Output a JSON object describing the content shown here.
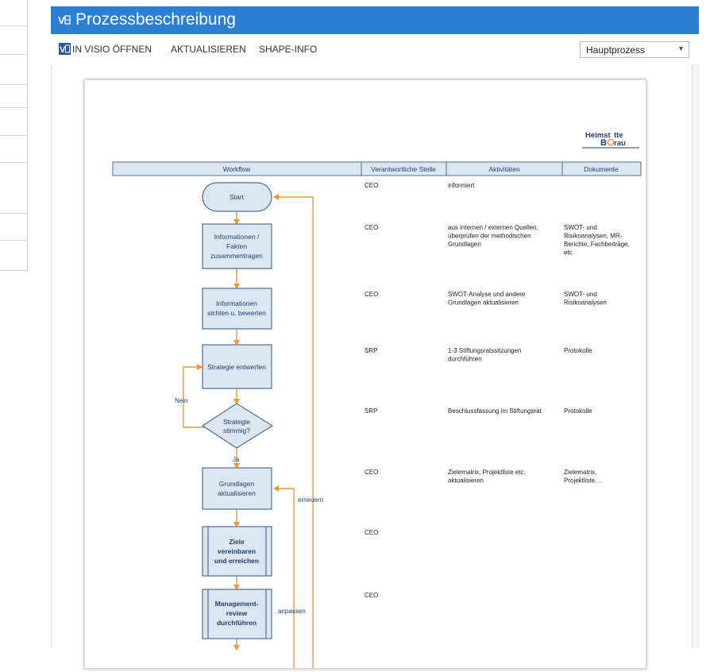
{
  "window": {
    "title": "Prozessbeschreibung"
  },
  "toolbar": {
    "open_in_visio": "IN VISIO ÖFFNEN",
    "refresh": "AKTUALISIEREN",
    "shape_info": "SHAPE-INFO",
    "page_select": {
      "value": "Hauptprozess"
    }
  },
  "diagram": {
    "logo": {
      "line1": "Heimst",
      "line1b": "tte",
      "line2a": "B",
      "line2b": "rau"
    },
    "columns": [
      "Workflow",
      "Verantwortliche Stelle",
      "Aktivitäten",
      "Dokumente"
    ],
    "shapes": {
      "start": "Start",
      "step1": [
        "Informationen /",
        "Fakten",
        "zusammentragen"
      ],
      "step2": [
        "Informationen",
        "sichten u. bewerten"
      ],
      "step3": "Strategie entwerfen",
      "decision": [
        "Strategie",
        "stimmig?"
      ],
      "step4": [
        "Grundlagen",
        "aktualisieren"
      ],
      "sub1": [
        "Ziele",
        "vereinbaren",
        "und erreichen"
      ],
      "sub2": [
        "Management-",
        "review",
        "durchführen"
      ]
    },
    "flow_labels": {
      "no": "Nein",
      "yes": "Ja",
      "renew": "erneuern",
      "adjust": "anpassen"
    },
    "rows": [
      {
        "stelle": "CEO",
        "aktivitaeten": [
          "informiert"
        ],
        "dokumente": []
      },
      {
        "stelle": "CEO",
        "aktivitaeten": [
          "aus internen / externen Quellen,",
          "überprüfen der methodischen",
          "Grundlagen"
        ],
        "dokumente": [
          "SWOT- und",
          "Risikoanalysen, MR-",
          "Berichte, Fachbeiträge,",
          "etc."
        ]
      },
      {
        "stelle": "CEO",
        "aktivitaeten": [
          "SWOT-Analyse und andere",
          "Grundlagen aktualisieren"
        ],
        "dokumente": [
          "SWOT- und",
          "Risikoanalysen"
        ]
      },
      {
        "stelle": "SRP",
        "aktivitaeten": [
          "1-3 Stiftungsratssitzungen",
          "durchführen"
        ],
        "dokumente": [
          "Protokolle"
        ]
      },
      {
        "stelle": "SRP",
        "aktivitaeten": [
          "Beschlussfassung im Stiftungsrat"
        ],
        "dokumente": [
          "Protokolle"
        ]
      },
      {
        "stelle": "CEO",
        "aktivitaeten": [
          "Zielematrix, Projektliste etc.",
          "aktualisieren"
        ],
        "dokumente": [
          "Zielematrix,",
          "Projektliste, .."
        ]
      },
      {
        "stelle": "CEO",
        "aktivitaeten": [],
        "dokumente": []
      },
      {
        "stelle": "CEO",
        "aktivitaeten": [],
        "dokumente": []
      }
    ]
  },
  "colors": {
    "title_bar": "#2b7fd4",
    "shape_fill": "#dce6f1",
    "shape_stroke": "#4f6f96",
    "connector": "#f0962e",
    "text_blue": "#1f3f6e"
  }
}
